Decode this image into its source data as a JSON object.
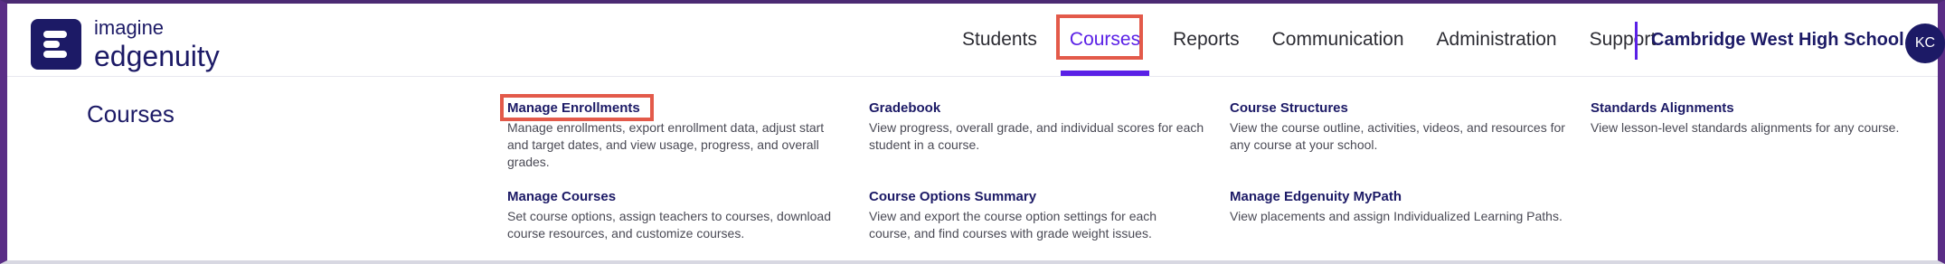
{
  "brand": {
    "line1": "imagine",
    "line2": "edgenuity",
    "accent": "#5a20e6",
    "navy": "#1c1a66",
    "highlight": "#e35a4a"
  },
  "nav": {
    "items": [
      {
        "label": "Students"
      },
      {
        "label": "Courses",
        "active": true
      },
      {
        "label": "Reports"
      },
      {
        "label": "Communication"
      },
      {
        "label": "Administration"
      },
      {
        "label": "Support"
      }
    ],
    "school": "Cambridge West High School",
    "avatar_initials": "KC"
  },
  "menu": {
    "title": "Courses",
    "items": [
      {
        "title": "Manage Enrollments",
        "description": "Manage enrollments, export enrollment data, adjust start and target dates, and view usage, progress, and overall grades.",
        "highlighted": true
      },
      {
        "title": "Gradebook",
        "description": "View progress, overall grade, and individual scores for each student in a course."
      },
      {
        "title": "Course Structures",
        "description": "View the course outline, activities, videos, and resources for any course at your school."
      },
      {
        "title": "Standards Alignments",
        "description": "View lesson-level standards alignments for any course."
      },
      {
        "title": "Manage Courses",
        "description": "Set course options, assign teachers to courses, download course resources, and customize courses."
      },
      {
        "title": "Course Options Summary",
        "description": "View and export the course option settings for each course, and find courses with grade weight issues."
      },
      {
        "title": "Manage Edgenuity MyPath",
        "description": "View placements and assign Individualized Learning Paths."
      }
    ]
  }
}
